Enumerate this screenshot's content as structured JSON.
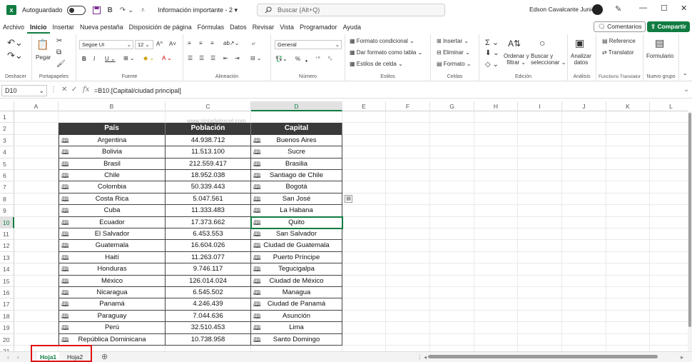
{
  "titlebar": {
    "autosave_label": "Autoguardado",
    "doc_title": "Información importante - 2",
    "search_placeholder": "Buscar (Alt+Q)",
    "user_name": "Edson Cavalcante Junior"
  },
  "menu": [
    "Archivo",
    "Inicio",
    "Insertar",
    "Nueva pestaña",
    "Disposición de página",
    "Fórmulas",
    "Datos",
    "Revisar",
    "Vista",
    "Programador",
    "Ayuda"
  ],
  "menu_active_index": 1,
  "comments_label": "Comentarios",
  "share_label": "Compartir",
  "ribbon": {
    "undo_label": "Deshacer",
    "clipboard_label": "Portapapeles",
    "paste_label": "Pegar",
    "font_label": "Fuente",
    "font_name": "Segoe UI",
    "font_size": "12",
    "align_label": "Alineación",
    "number_label": "Número",
    "number_format": "General",
    "cond_format": "Formato condicional",
    "table_format": "Dar formato como tabla",
    "cell_styles": "Estilos de celda",
    "styles_label": "Estilos",
    "insert": "Insertar",
    "delete": "Eliminar",
    "format": "Formato",
    "cells_label": "Celdas",
    "sort_filter_1": "Ordenar y",
    "sort_filter_2": "filtrar",
    "find_1": "Buscar y",
    "find_2": "seleccionar",
    "editing_label": "Edición",
    "analyze_1": "Analizar",
    "analyze_2": "datos",
    "analysis_label": "Análisis",
    "reference": "Reference",
    "translator": "Translator",
    "functions_label": "Functions Translator",
    "form": "Formulario",
    "new_group_label": "Nuevo grupo"
  },
  "formula_bar": {
    "name_box": "D10",
    "formula": "=B10.[Capital/ciudad principal]"
  },
  "columns": [
    "A",
    "B",
    "C",
    "D",
    "E",
    "F",
    "G",
    "H",
    "I",
    "J",
    "K",
    "L"
  ],
  "selected_column": "D",
  "selected_row": 10,
  "watermark": "www.ninjadelexcel.com",
  "table": {
    "headers": [
      "País",
      "Población",
      "Capital"
    ],
    "rows": [
      [
        "Argentina",
        "44.938.712",
        "Buenos Aires"
      ],
      [
        "Bolivia",
        "11.513.100",
        "Sucre"
      ],
      [
        "Brasil",
        "212.559.417",
        "Brasilia"
      ],
      [
        "Chile",
        "18.952.038",
        "Santiago de Chile"
      ],
      [
        "Colombia",
        "50.339.443",
        "Bogotá"
      ],
      [
        "Costa Rica",
        "5.047.561",
        "San José"
      ],
      [
        "Cuba",
        "11.333.483",
        "La Habana"
      ],
      [
        "Ecuador",
        "17.373.662",
        "Quito"
      ],
      [
        "El Salvador",
        "6.453.553",
        "San Salvador"
      ],
      [
        "Guatemala",
        "16.604.026",
        "Ciudad de Guatemala"
      ],
      [
        "Haití",
        "11.263.077",
        "Puerto Príncipe"
      ],
      [
        "Honduras",
        "9.746.117",
        "Tegucigalpa"
      ],
      [
        "México",
        "126.014.024",
        "Ciudad de México"
      ],
      [
        "Nicaragua",
        "6.545.502",
        "Managua"
      ],
      [
        "Panamá",
        "4.246.439",
        "Ciudad de Panamá"
      ],
      [
        "Paraguay",
        "7.044.636",
        "Asunción"
      ],
      [
        "Perú",
        "32.510.453",
        "Lima"
      ],
      [
        "República Dominicana",
        "10.738.958",
        "Santo Domingo"
      ]
    ]
  },
  "sheets": [
    "Hoja1",
    "Hoja2"
  ],
  "active_sheet": "Hoja1",
  "colors": {
    "accent": "#107c41",
    "header_bg": "#3a3a3a",
    "highlight_box": "#e01010"
  }
}
